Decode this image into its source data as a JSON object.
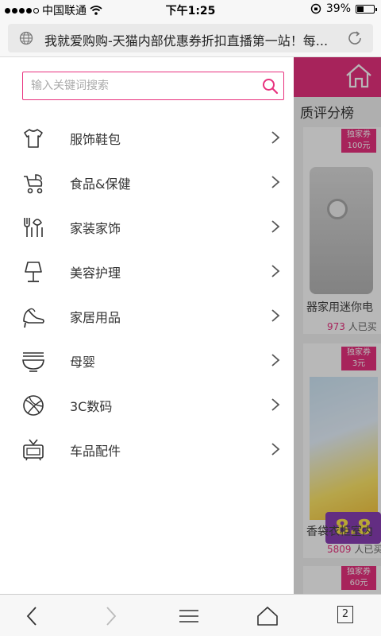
{
  "status_bar": {
    "carrier": "中国联通",
    "time": "下午1:25",
    "battery": "39%",
    "battery_level": 0.39
  },
  "browser": {
    "page_title": "我就爱购购-天猫内部优惠券折扣直播第一站！每..."
  },
  "drawer": {
    "search_placeholder": "输入关键词搜索",
    "categories": [
      {
        "label": "服饰鞋包",
        "icon": "tshirt-icon"
      },
      {
        "label": "食品&保健",
        "icon": "stroller-icon"
      },
      {
        "label": "家装家饰",
        "icon": "utensils-icon"
      },
      {
        "label": "美容护理",
        "icon": "lamp-icon"
      },
      {
        "label": "家居用品",
        "icon": "high-heel-icon"
      },
      {
        "label": "母婴",
        "icon": "bowl-icon"
      },
      {
        "label": "3C数码",
        "icon": "ball-icon"
      },
      {
        "label": "车品配件",
        "icon": "tv-icon"
      }
    ]
  },
  "background_page": {
    "tab_label": "质评分榜",
    "products": [
      {
        "badge": "独家券",
        "badge_value": "100元",
        "title": "器家用迷你电",
        "sales": "973",
        "sales_suffix": "人已买"
      },
      {
        "badge": "独家券",
        "badge_value": "3元",
        "title": "香袋衣柜室内",
        "sales": "5809",
        "sales_suffix": "人已买",
        "price": "8.8"
      },
      {
        "badge": "独家券",
        "badge_value": "60元"
      }
    ]
  },
  "toolbar": {
    "tab_count": "2"
  },
  "colors": {
    "accent": "#e8317e"
  }
}
